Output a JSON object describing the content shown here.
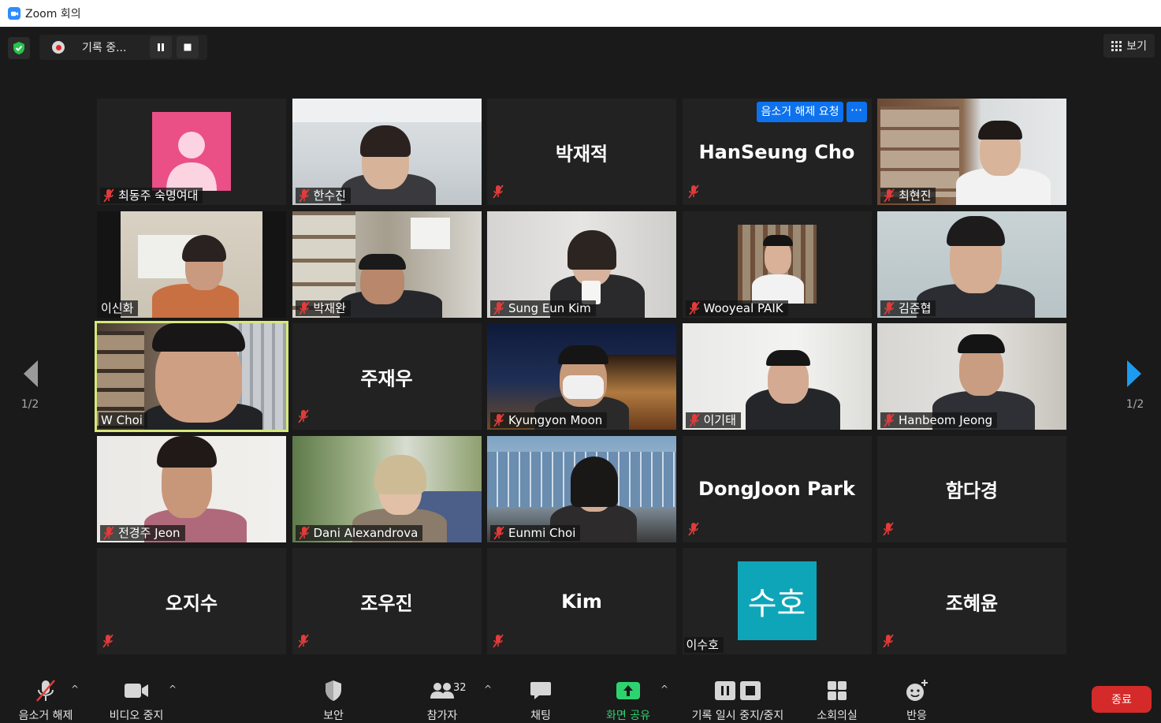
{
  "window": {
    "title": "Zoom 회의"
  },
  "recording": {
    "label": "기록 중..."
  },
  "view": {
    "label": "보기"
  },
  "unmute_request": {
    "label": "음소거 해제 요청",
    "more": "···"
  },
  "pager": {
    "left": "1/2",
    "right": "1/2"
  },
  "tiles": [
    {
      "name": "최동주 숙명여대",
      "type": "avatar",
      "avatar_color": "#ea4f86"
    },
    {
      "name": "한수진",
      "type": "video"
    },
    {
      "name": "박재적",
      "type": "nametile"
    },
    {
      "name": "HanSeung Cho",
      "type": "nametile"
    },
    {
      "name": "최현진",
      "type": "video"
    },
    {
      "name": "이신화",
      "type": "video"
    },
    {
      "name": "박재완",
      "type": "video"
    },
    {
      "name": "Sung Eun Kim",
      "type": "video"
    },
    {
      "name": "Wooyeal PAIK",
      "type": "video"
    },
    {
      "name": "김준협",
      "type": "video"
    },
    {
      "name": "W Choi",
      "type": "video"
    },
    {
      "name": "주재우",
      "type": "nametile"
    },
    {
      "name": "Kyungyon Moon",
      "type": "video"
    },
    {
      "name": "이기태",
      "type": "video"
    },
    {
      "name": "Hanbeom Jeong",
      "type": "video"
    },
    {
      "name": "전경주 Jeon",
      "type": "video"
    },
    {
      "name": "Dani Alexandrova",
      "type": "video"
    },
    {
      "name": "Eunmi Choi",
      "type": "video"
    },
    {
      "name": "DongJoon Park",
      "type": "nametile"
    },
    {
      "name": "함다경",
      "type": "nametile"
    },
    {
      "name": "오지수",
      "type": "nametile"
    },
    {
      "name": "조우진",
      "type": "nametile"
    },
    {
      "name": "Kim",
      "type": "nametile"
    },
    {
      "name": "이수호",
      "type": "avatar-text",
      "avatar_text": "수호",
      "avatar_color": "#0ea5b8"
    },
    {
      "name": "조혜윤",
      "type": "nametile"
    }
  ],
  "toolbar": {
    "unmute": "음소거 해제",
    "stop_video": "비디오 중지",
    "security": "보안",
    "participants": "참가자",
    "participants_count": "32",
    "chat": "채팅",
    "share_screen": "화면 공유",
    "recording_pause_stop": "기록 일시 중지/중지",
    "breakout_rooms": "소회의실",
    "reactions": "반응",
    "end": "종료"
  },
  "colors": {
    "accent": "#0e72ed",
    "end": "#d42a2a",
    "share": "#2dd36f",
    "active_speaker": "#d6e87a",
    "mute": "#e23b3b"
  }
}
